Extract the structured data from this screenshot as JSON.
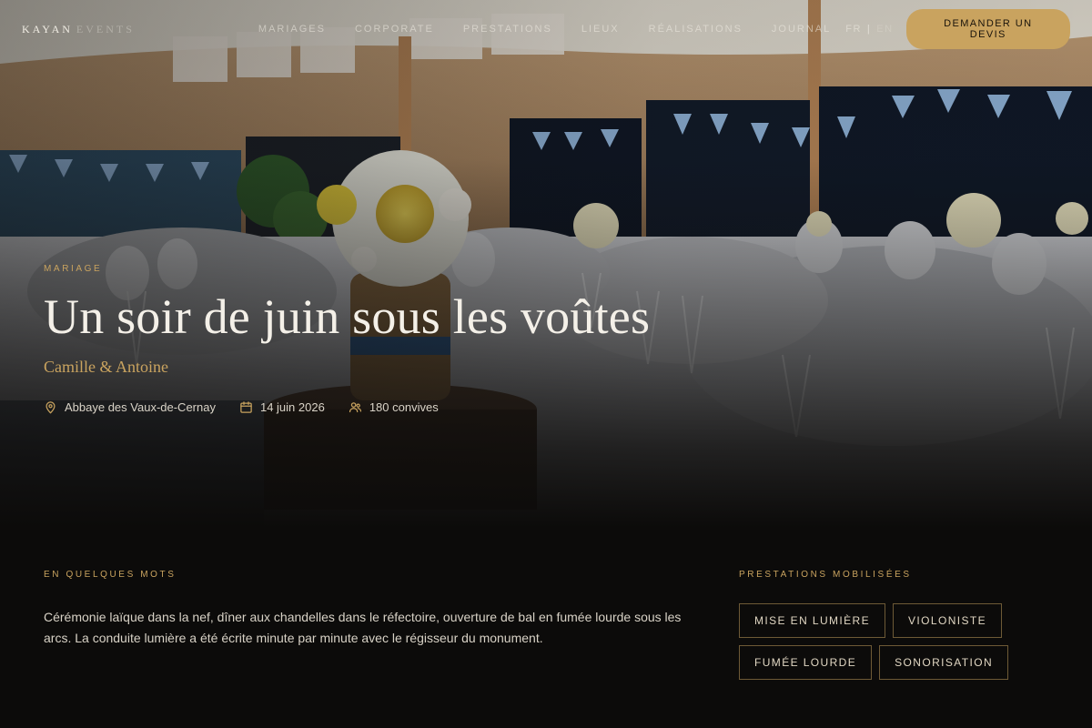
{
  "nav": {
    "logo_main": "KAYAN",
    "logo_muted": "EVENTS",
    "links": [
      "Mariages",
      "Corporate",
      "Prestations",
      "Lieux",
      "Réalisations",
      "Journal"
    ],
    "lang_active": "FR",
    "lang_separator": "|",
    "lang_other": "EN",
    "cta_label": "Demander un devis"
  },
  "hero": {
    "kicker": "Mariage",
    "title": "Un soir de juin sous les voûtes",
    "subtitle": "Camille & Antoine",
    "meta": {
      "location": "Abbaye des Vaux-de-Cernay",
      "date": "14 juin 2026",
      "guests": "180 convives"
    }
  },
  "about": {
    "label": "En quelques mots",
    "text": "Cérémonie laïque dans la nef, dîner aux chandelles dans le réfectoire, ouverture de bal en fumée lourde sous les arcs. La conduite lumière a été écrite minute par minute avec le régisseur du monument."
  },
  "services": {
    "label": "Prestations mobilisées",
    "tags": [
      "Mise en lumière",
      "Violoniste",
      "Fumée lourde",
      "Sonorisation"
    ]
  },
  "colors": {
    "accent": "#c9a35f",
    "background": "#0c0b0a",
    "text": "#f4f0e8"
  },
  "icons": {
    "location": "map-pin-icon",
    "date": "calendar-icon",
    "guests": "users-icon"
  }
}
